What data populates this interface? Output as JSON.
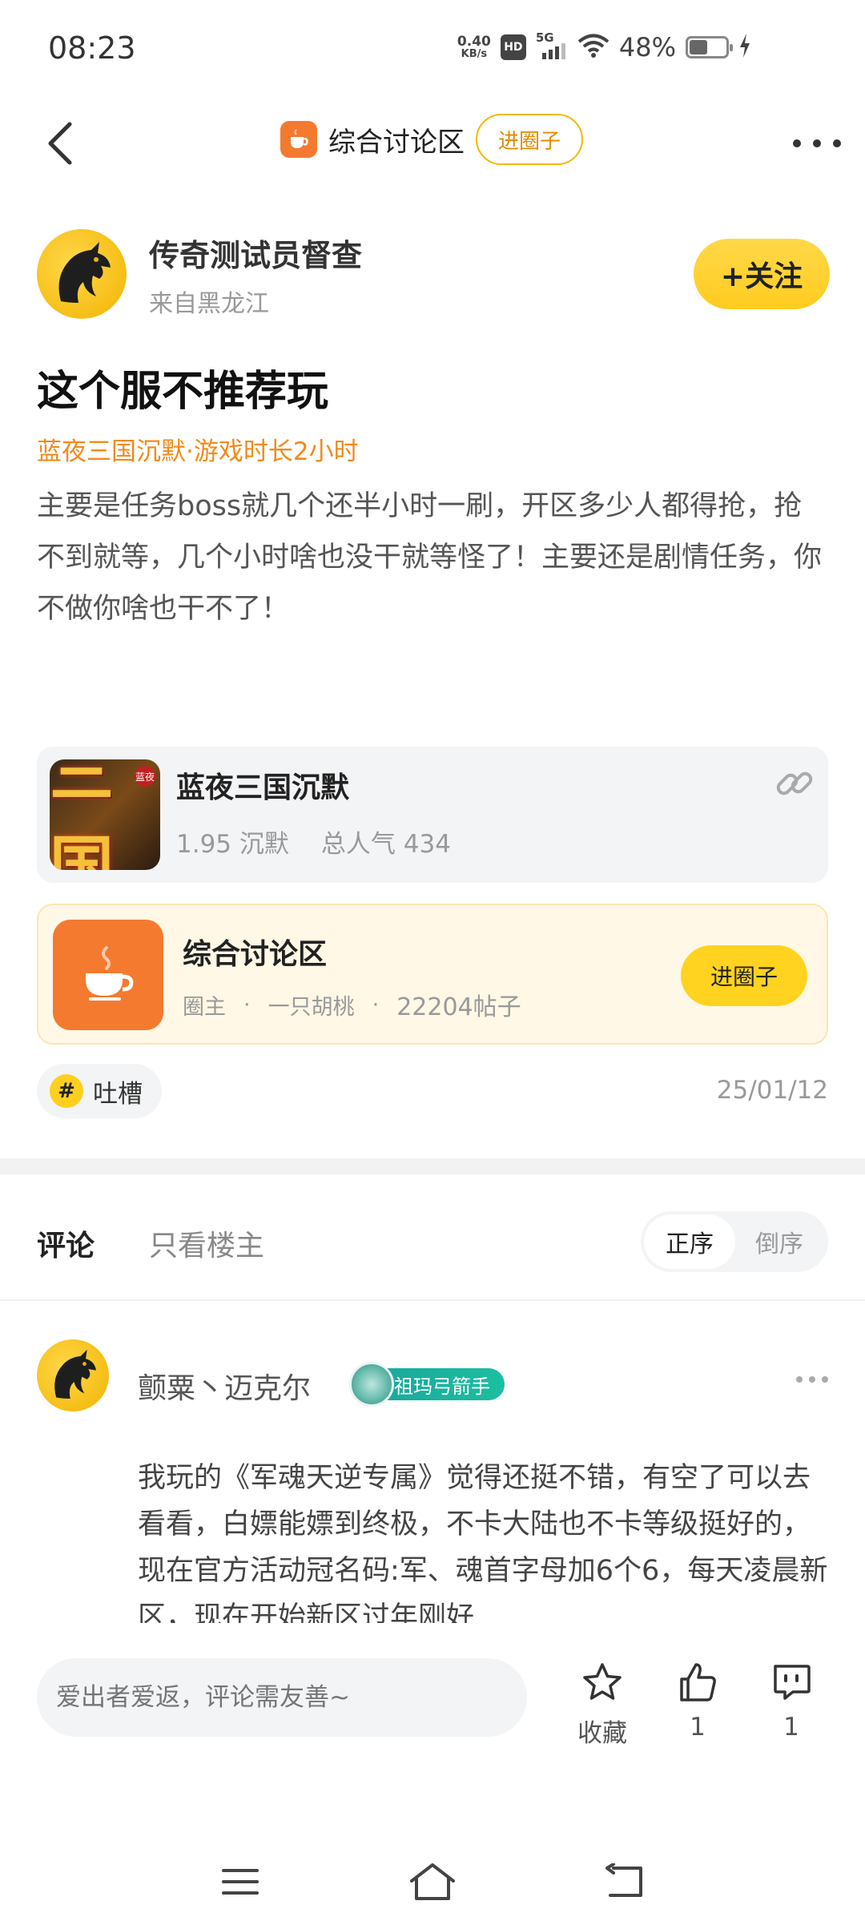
{
  "status_bar": {
    "time": "08:23",
    "net_speed_value": "0.40",
    "net_speed_unit": "KB/s",
    "hd": "HD",
    "network": "5G",
    "battery": "48%"
  },
  "header": {
    "circle_name": "综合讨论区",
    "enter_circle": "进圈子"
  },
  "post": {
    "author_name": "传奇测试员督查",
    "author_from": "来自黑龙江",
    "follow_label": "+关注",
    "title": "这个服不推荐玩",
    "meta": "蓝夜三国沉默·游戏时长2小时",
    "body": "主要是任务boss就几个还半小时一刷，开区多少人都得抢，抢不到就等，几个小时啥也没干就等怪了！主要还是剧情任务，你不做你啥也干不了！",
    "tag": "吐槽",
    "date": "25/01/12"
  },
  "game_card": {
    "icon_text": "三国",
    "icon_badge": "蓝夜",
    "name": "蓝夜三国沉默",
    "version": "1.95 沉默",
    "popularity": "总人气 434"
  },
  "circle_card": {
    "name": "综合讨论区",
    "owner_label": "圈主",
    "owner_name": "一只胡桃",
    "posts": "22204帖子",
    "join_label": "进圈子"
  },
  "comments": {
    "tab_comments": "评论",
    "tab_owner_only": "只看楼主",
    "sort_asc": "正序",
    "sort_desc": "倒序",
    "items": [
      {
        "user": "颤粟丶迈克尔",
        "badge": "祖玛弓箭手",
        "text": "我玩的《军魂天逆专属》觉得还挺不错，有空了可以去看看，白嫖能嫖到终极，不卡大陆也不卡等级挺好的，现在官方活动冠名码:军、魂首字母加6个6，每天凌晨新区，现在开始新区过年刚好"
      }
    ]
  },
  "action_bar": {
    "input_placeholder": "爱出者爱返，评论需友善~",
    "favorite_label": "收藏",
    "like_count": "1",
    "comment_count": "1"
  },
  "colors": {
    "accent_yellow": "#ffd31f",
    "meta_orange": "#f08a1c",
    "circle_orange": "#f47a30"
  },
  "icons": [
    "back-arrow-icon",
    "cup-icon",
    "more-dots-icon",
    "link-icon",
    "hash-icon",
    "star-icon",
    "thumbs-up-icon",
    "comment-icon",
    "menu-icon",
    "home-icon",
    "back-icon"
  ]
}
